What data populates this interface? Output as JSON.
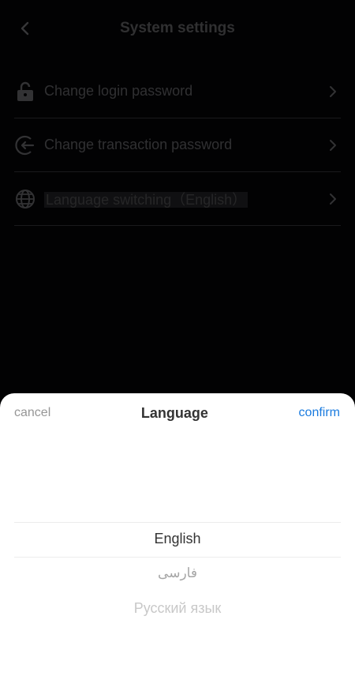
{
  "header": {
    "title": "System settings",
    "back_icon": "chevron-left-icon"
  },
  "settings": {
    "items": [
      {
        "label": "Change login password",
        "icon": "lock-icon"
      },
      {
        "label": "Change transaction password",
        "icon": "exit-circle-icon"
      },
      {
        "label": "Language switching（English）",
        "icon": "globe-icon"
      }
    ]
  },
  "sheet": {
    "cancel_label": "cancel",
    "title": "Language",
    "confirm_label": "confirm",
    "options": [
      "English",
      "فارسی",
      "Русский язык"
    ],
    "selected": "English"
  },
  "colors": {
    "confirm": "#1a7bdf",
    "background": "#050507"
  }
}
